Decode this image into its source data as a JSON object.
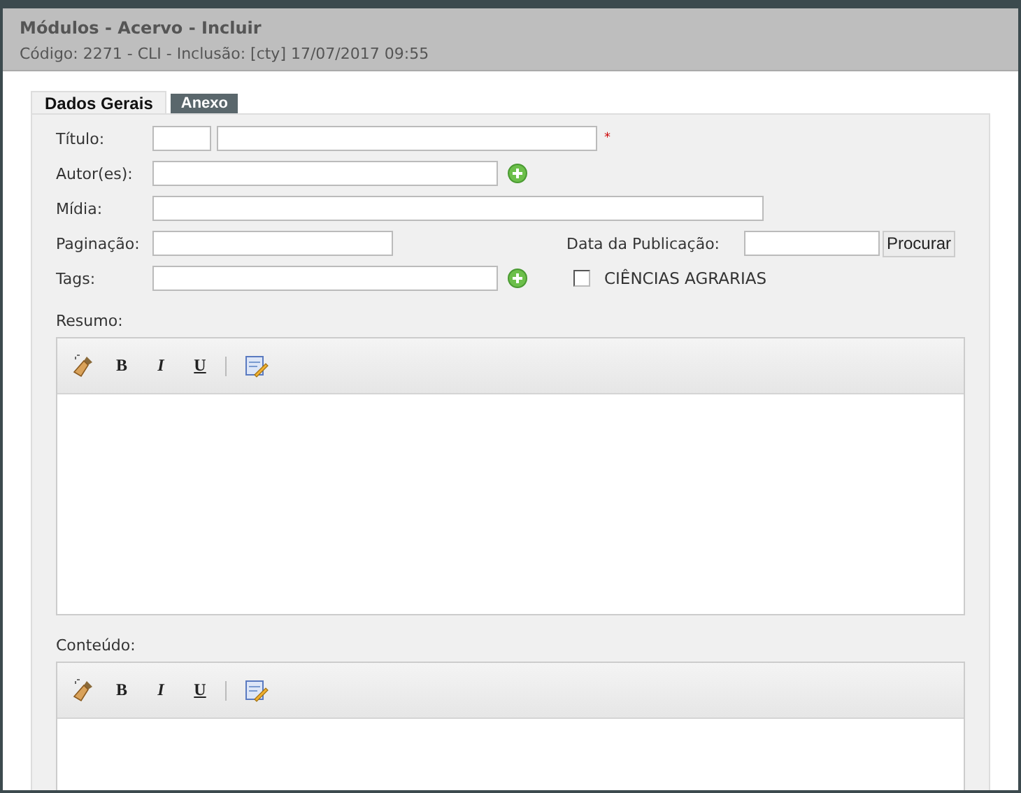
{
  "header": {
    "title": "Módulos - Acervo - Incluir",
    "subtitle": "Código: 2271 - CLI - Inclusão: [cty] 17/07/2017 09:55"
  },
  "tabs": [
    {
      "label": "Dados Gerais",
      "selected": true
    },
    {
      "label": "Anexo",
      "selected": false
    }
  ],
  "form": {
    "titulo_label": "Título:",
    "required_mark": "*",
    "autores_label": "Autor(es):",
    "midia_label": "Mídia:",
    "paginacao_label": "Paginação:",
    "data_label": "Data da Publicação:",
    "procurar_button": "Procurar",
    "tags_label": "Tags:",
    "category": {
      "label": "CIÊNCIAS AGRARIAS",
      "checked": false
    }
  },
  "editors": [
    {
      "label": "Resumo:",
      "bold": "B",
      "italic": "I",
      "underline": "U"
    },
    {
      "label": "Conteúdo:",
      "bold": "B",
      "italic": "I",
      "underline": "U"
    }
  ]
}
